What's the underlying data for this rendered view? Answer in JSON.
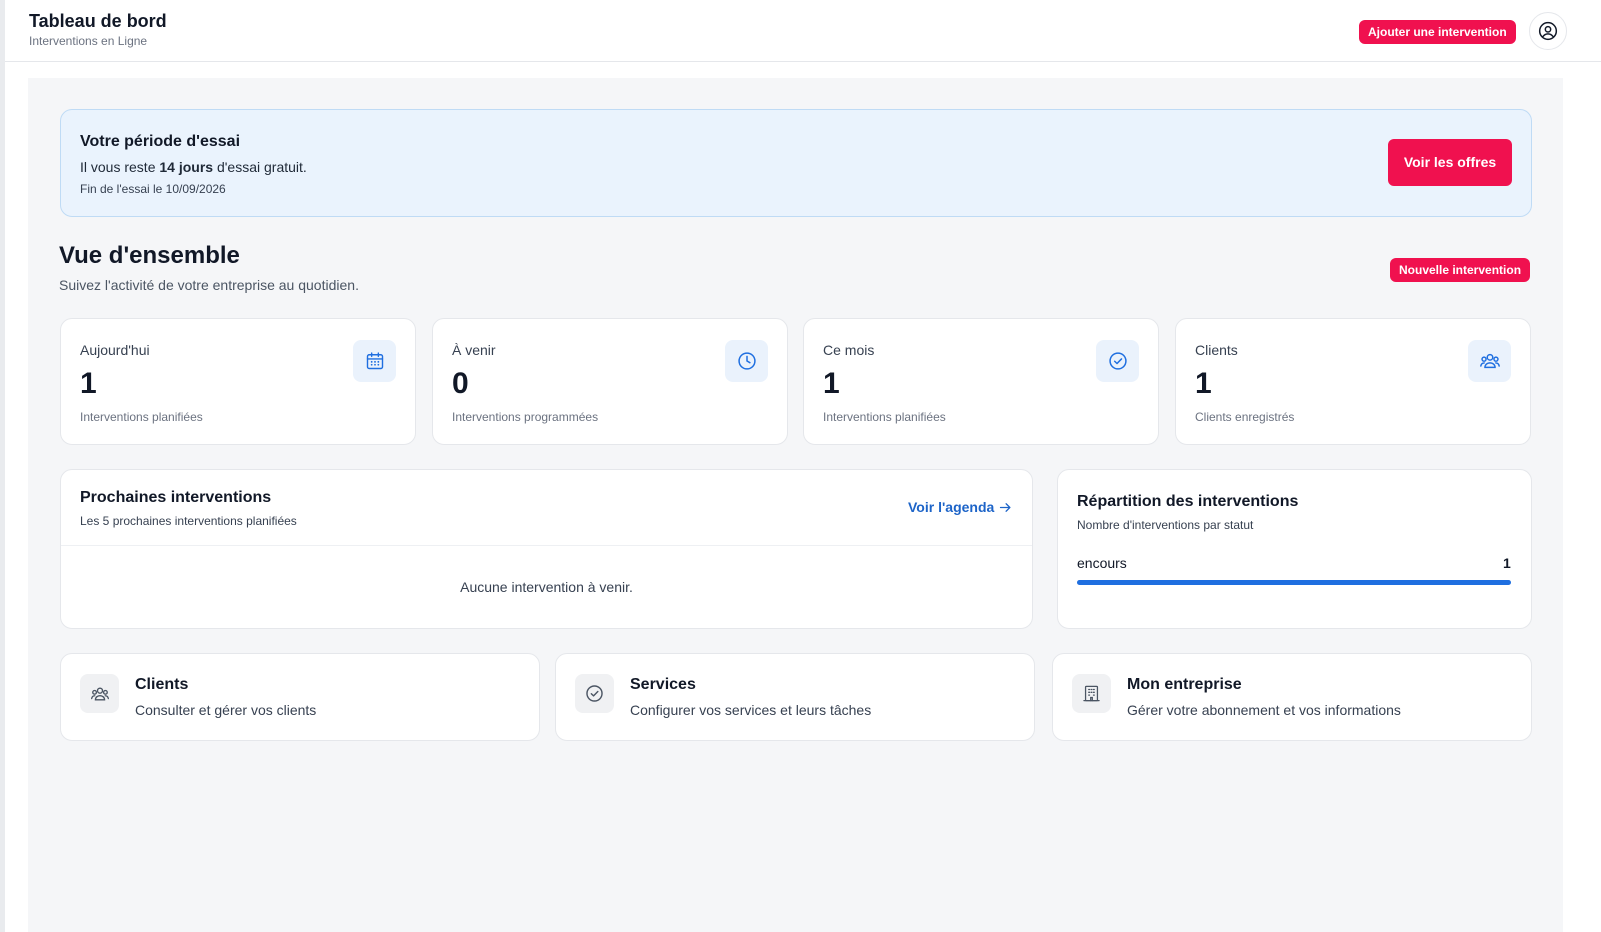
{
  "header": {
    "title": "Tableau de bord",
    "subtitle": "Interventions en Ligne",
    "add_button": "Ajouter une intervention",
    "account_icon": "user-circle-icon"
  },
  "trial": {
    "title": "Votre période d'essai",
    "line_prefix": "Il vous reste ",
    "days": "14 jours",
    "line_suffix": " d'essai gratuit.",
    "end": "Fin de l'essai le 10/09/2026",
    "offers_button": "Voir les offres"
  },
  "overview": {
    "title": "Vue d'ensemble",
    "subtitle": "Suivez l'activité de votre entreprise au quotidien.",
    "new_button": "Nouvelle intervention"
  },
  "stats": [
    {
      "label": "Aujourd'hui",
      "value": "1",
      "desc": "Interventions planifiées",
      "icon": "calendar-icon"
    },
    {
      "label": "À venir",
      "value": "0",
      "desc": "Interventions programmées",
      "icon": "clock-icon"
    },
    {
      "label": "Ce mois",
      "value": "1",
      "desc": "Interventions planifiées",
      "icon": "check-circle-icon"
    },
    {
      "label": "Clients",
      "value": "1",
      "desc": "Clients enregistrés",
      "icon": "users-icon"
    }
  ],
  "upcoming": {
    "title": "Prochaines interventions",
    "subtitle": "Les 5 prochaines interventions planifiées",
    "agenda_link": "Voir l'agenda",
    "empty": "Aucune intervention à venir."
  },
  "distribution": {
    "title": "Répartition des interventions",
    "subtitle": "Nombre d'interventions par statut",
    "statuses": [
      {
        "label": "encours",
        "count": "1",
        "fraction": 1.0
      }
    ]
  },
  "shortcuts": [
    {
      "title": "Clients",
      "subtitle": "Consulter et gérer vos clients",
      "icon": "users-icon"
    },
    {
      "title": "Services",
      "subtitle": "Configurer vos services et leurs tâches",
      "icon": "check-circle-icon"
    },
    {
      "title": "Mon entreprise",
      "subtitle": "Gérer votre abonnement et vos informations",
      "icon": "building-icon"
    }
  ],
  "colors": {
    "accent": "#f0114f",
    "primary_blue": "#1f6fe0",
    "link_blue": "#1d64c8",
    "trial_bg": "#eaf3fd"
  }
}
